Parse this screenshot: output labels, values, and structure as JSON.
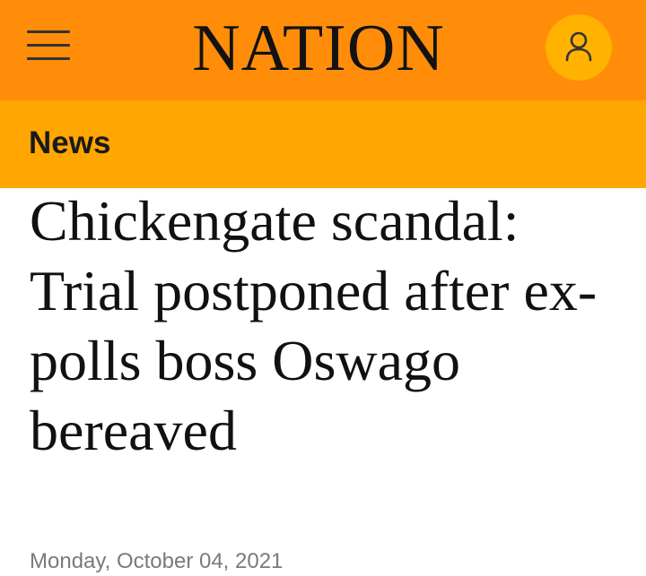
{
  "header": {
    "logo_text": "NATION",
    "menu_icon": "hamburger-menu-icon",
    "account_icon": "user-icon",
    "background_color": "#ff8d0a",
    "account_button_color": "#ffb200"
  },
  "section": {
    "label": "News",
    "background_color": "#ffa600"
  },
  "article": {
    "headline": "Chickengate scandal: Trial postponed after ex-polls boss Oswago bereaved",
    "date": "Monday, October 04, 2021"
  }
}
